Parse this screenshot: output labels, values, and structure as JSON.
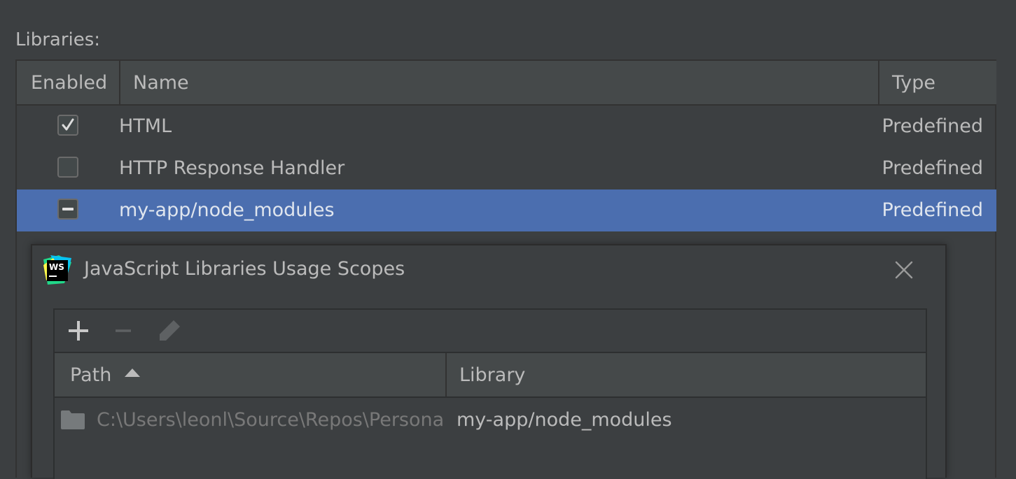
{
  "libraries": {
    "label": "Libraries:",
    "columns": {
      "enabled": "Enabled",
      "name": "Name",
      "type": "Type"
    },
    "rows": [
      {
        "enabled": "checked",
        "name": "HTML",
        "type": "Predefined"
      },
      {
        "enabled": "unchecked",
        "name": "HTTP Response Handler",
        "type": "Predefined"
      },
      {
        "enabled": "partial",
        "name": "my-app/node_modules",
        "type": "Predefined",
        "selected": true
      }
    ]
  },
  "dialog": {
    "title": "JavaScript Libraries Usage Scopes",
    "logo_text": "WS",
    "toolbar": {
      "add_icon": "plus-icon",
      "remove_icon": "minus-icon",
      "edit_icon": "pencil-icon"
    },
    "columns": {
      "path": "Path",
      "library": "Library"
    },
    "sort": "ascending",
    "rows": [
      {
        "path": "C:\\Users\\leonl\\Source\\Repos\\Persona",
        "library": "my-app/node_modules"
      }
    ]
  },
  "colors": {
    "background": "#3c3f41",
    "header": "#45494a",
    "selection": "#4b6eaf",
    "text": "#bbbbbb",
    "muted_text": "#787878"
  }
}
